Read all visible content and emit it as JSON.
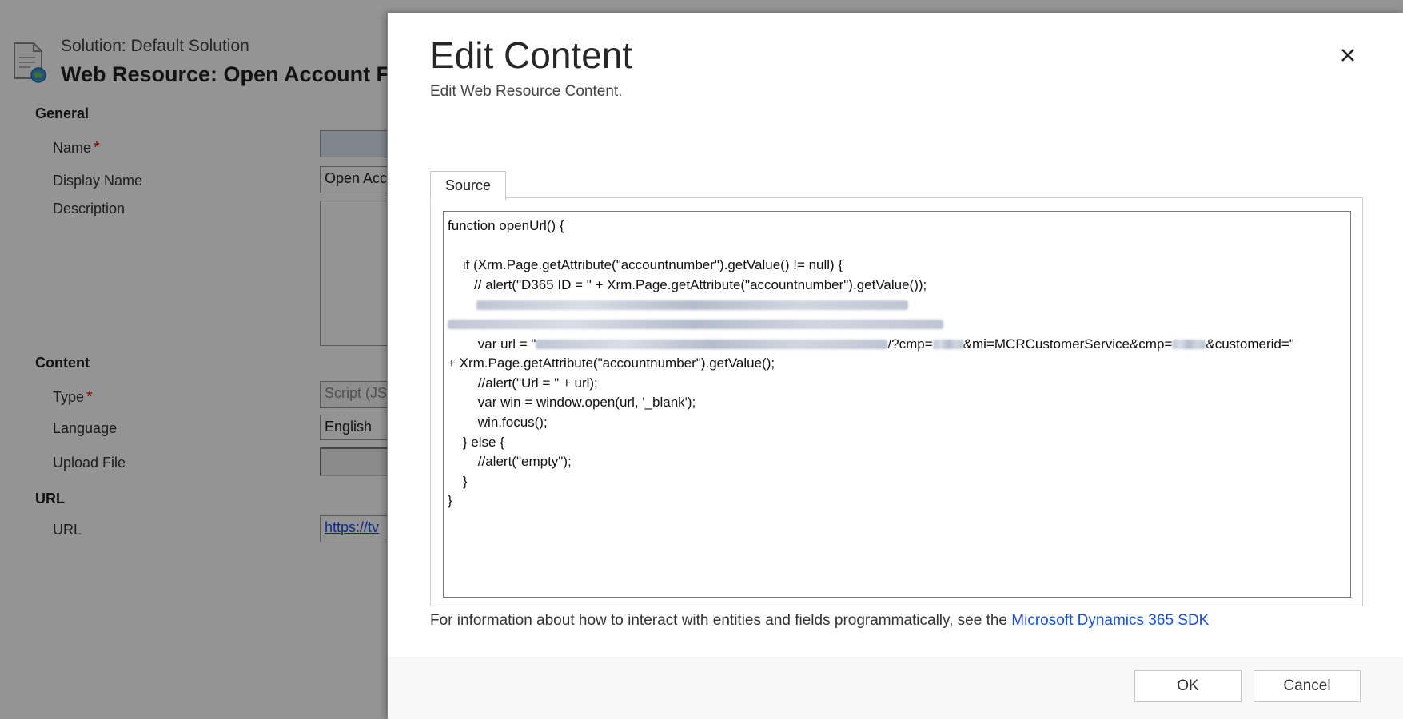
{
  "background": {
    "solution_label": "Solution: Default Solution",
    "title": "Web Resource: Open Account Fo",
    "sections": {
      "general": "General",
      "content": "Content",
      "url": "URL"
    },
    "fields": {
      "name": {
        "label": "Name",
        "value": ""
      },
      "display_name": {
        "label": "Display Name",
        "value": "Open Acc"
      },
      "description": {
        "label": "Description",
        "value": ""
      },
      "type": {
        "label": "Type",
        "value": "Script (JS"
      },
      "language": {
        "label": "Language",
        "value": "English"
      },
      "upload_file": {
        "label": "Upload File",
        "value": ""
      },
      "url": {
        "label": "URL",
        "value": "https://tv"
      }
    },
    "required_marker": "*"
  },
  "dialog": {
    "title": "Edit Content",
    "subtitle": "Edit Web Resource Content.",
    "close_icon": "close-icon",
    "tab_label": "Source",
    "code": {
      "line1": "function openUrl() {",
      "line2": "",
      "line3": "    if (Xrm.Page.getAttribute(\"accountnumber\").getValue() != null) {",
      "line4": "       // alert(\"D365 ID = \" + Xrm.Page.getAttribute(\"accountnumber\").getValue());",
      "line7a": "        var url = \"",
      "line7b": "/?cmp=",
      "line7c": "&mi=MCRCustomerService&cmp=",
      "line7d": "&customerid=\"",
      "line8": "+ Xrm.Page.getAttribute(\"accountnumber\").getValue();",
      "line9": "        //alert(\"Url = \" + url);",
      "line10": "        var win = window.open(url, '_blank');",
      "line11": "        win.focus();",
      "line12": "    } else {",
      "line13": "        //alert(\"empty\");",
      "line14": "    }",
      "line15": "}"
    },
    "info_text": "For information about how to interact with entities and fields programmatically, see the ",
    "info_link": "Microsoft Dynamics 365 SDK",
    "ok_label": "OK",
    "cancel_label": "Cancel"
  }
}
